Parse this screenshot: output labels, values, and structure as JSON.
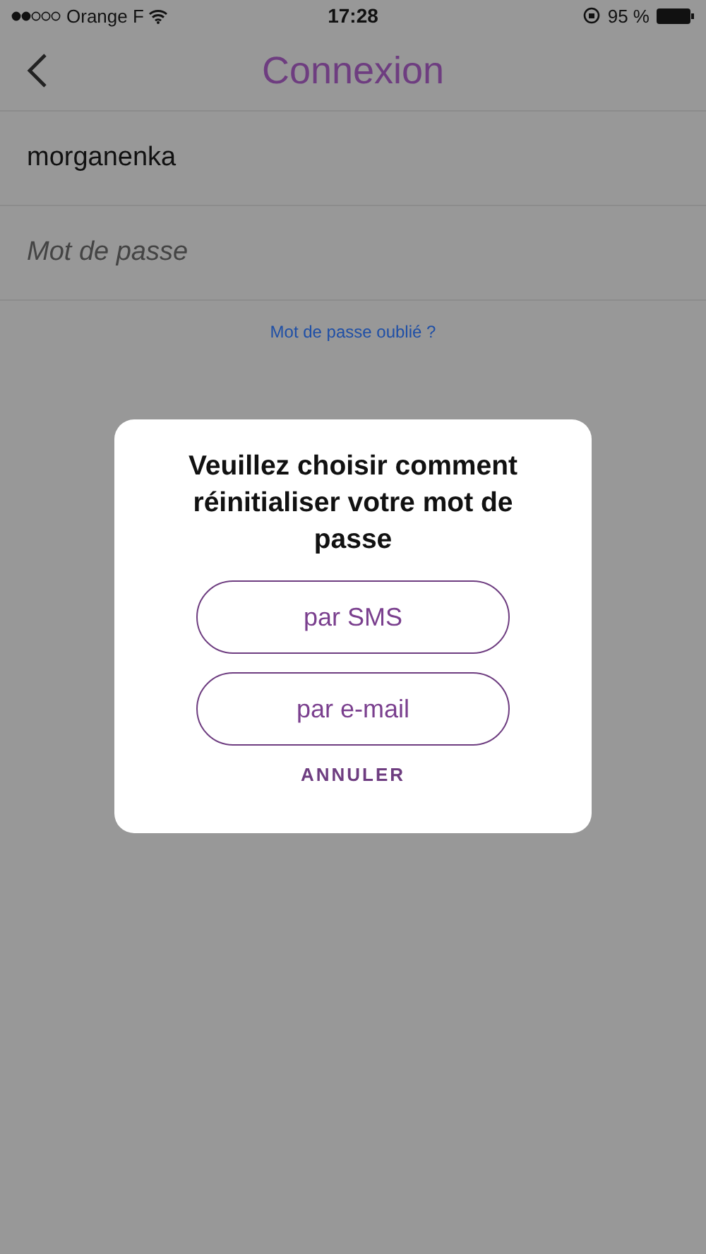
{
  "status_bar": {
    "carrier": "Orange F",
    "time": "17:28",
    "battery": "95 %"
  },
  "nav": {
    "title": "Connexion"
  },
  "form": {
    "username": {
      "value": "morganenka"
    },
    "password": {
      "placeholder": "Mot de passe"
    },
    "forgot_link": "Mot de passe oublié ?"
  },
  "dialog": {
    "message": "Veuillez choisir comment réinitialiser votre mot de passe",
    "options": [
      "par SMS",
      "par e-mail"
    ],
    "cancel": "ANNULER"
  }
}
